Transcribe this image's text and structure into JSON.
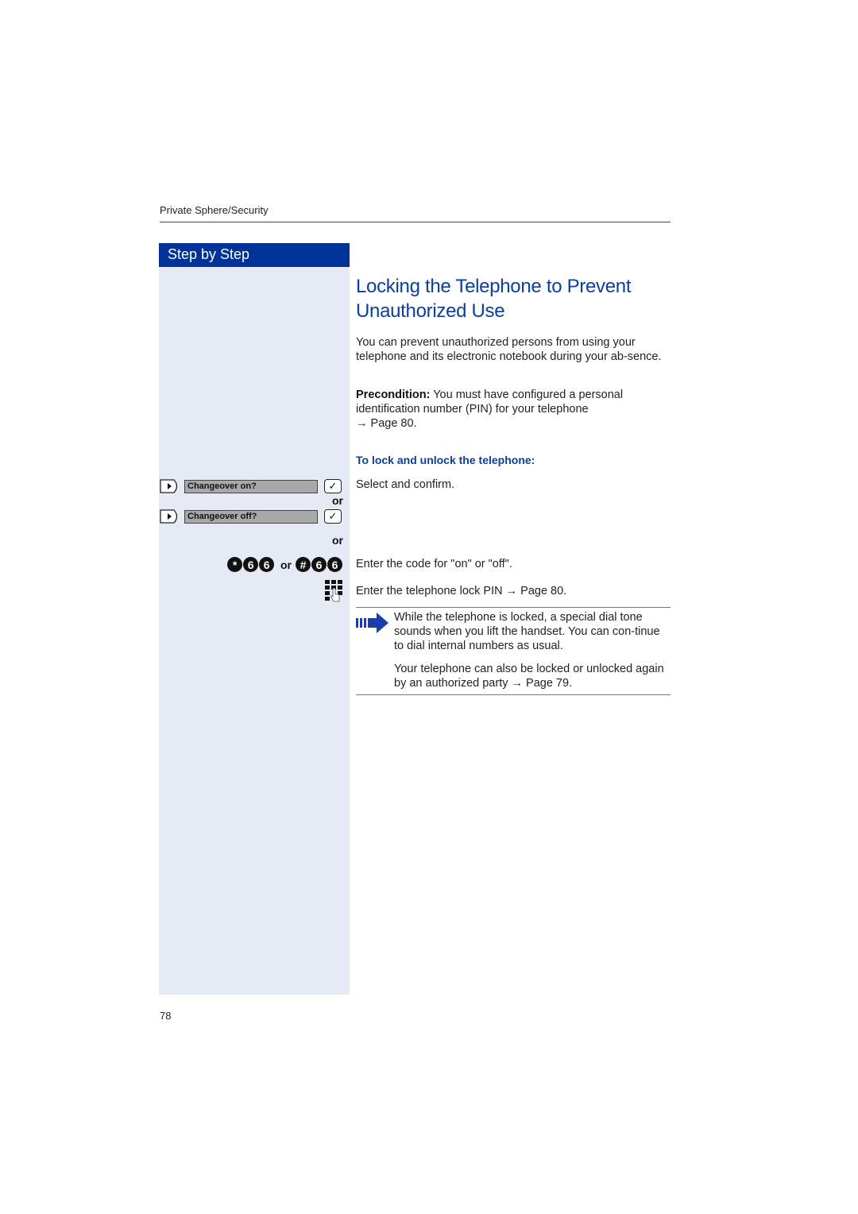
{
  "running_head": "Private Sphere/Security",
  "sidebar": {
    "header": "Step by Step"
  },
  "title_line1": "Locking the Telephone to Prevent",
  "title_line2": "Unauthorized Use",
  "intro": "You can prevent unauthorized persons from using your telephone and its electronic notebook during your ab-sence.",
  "precondition": {
    "label": "Precondition:",
    "text": " You must have configured a personal identification number (PIN) for your telephone",
    "ref": "→ Page 80."
  },
  "subheading": "To lock and unlock the telephone:",
  "steps": {
    "display_options": [
      {
        "label": "Changeover on?",
        "icon": "display-arrow-key-icon",
        "confirm_icon": "checkmark-key-icon"
      },
      {
        "label": "Changeover off?",
        "icon": "display-arrow-key-icon",
        "confirm_icon": "checkmark-key-icon"
      }
    ],
    "or_label": "or",
    "select_text": "Select and confirm.",
    "code_keys_on": [
      "*",
      "6",
      "6"
    ],
    "code_keys_off": [
      "#",
      "6",
      "6"
    ],
    "code_text": "Enter the code for \"on\" or \"off\".",
    "pin_text": "Enter the telephone lock PIN → Page 80."
  },
  "note": {
    "icon": "note-arrow-icon",
    "para1": "While the telephone is locked, a special dial tone sounds when you lift the handset. You can con-tinue to dial internal numbers as usual.",
    "para2": "Your telephone can also be locked or unlocked again by an authorized party → Page 79."
  },
  "colors": {
    "brand_blue": "#003399",
    "sidebar_bg": "#e5eaf4",
    "title_blue": "#0a3ea0"
  },
  "page_number": "78"
}
